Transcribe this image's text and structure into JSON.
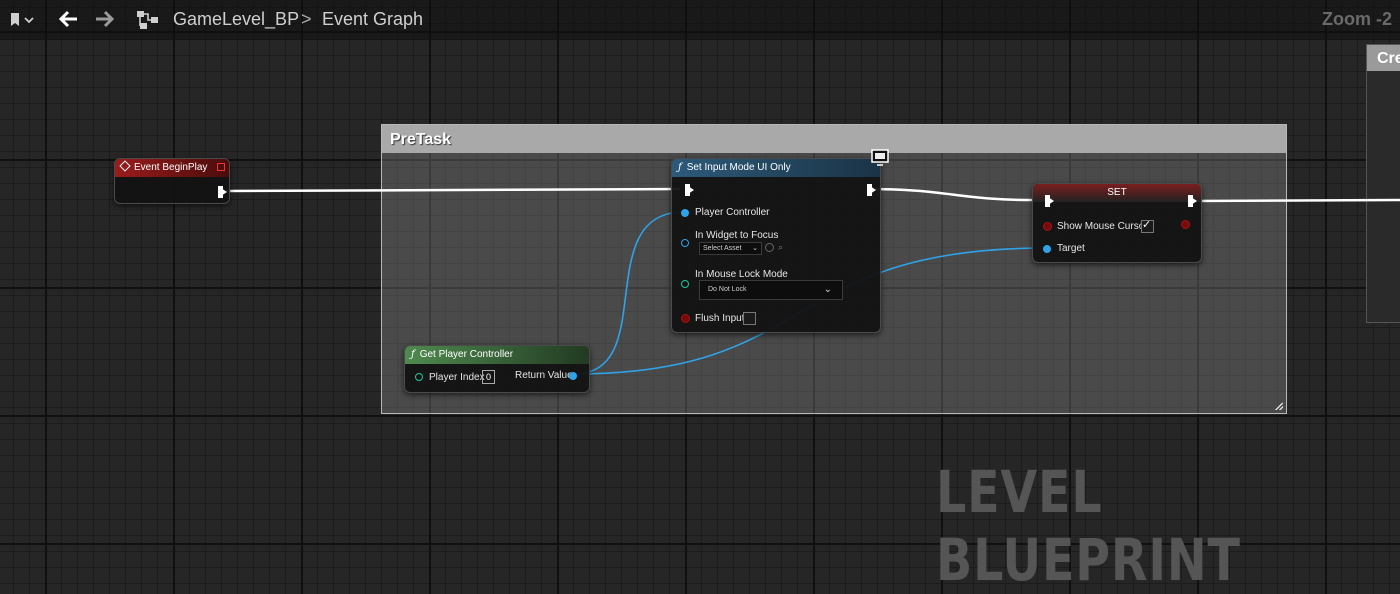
{
  "toolbar": {
    "blueprint_name": "GameLevel_BP",
    "separator": ">",
    "graph_name": "Event Graph",
    "zoom": "Zoom -2"
  },
  "comment": {
    "title": "PreTask"
  },
  "nodes": {
    "begin_play": {
      "title": "Event BeginPlay"
    },
    "set_input_mode": {
      "title": "Set Input Mode UI Only",
      "pins": {
        "player_controller": "Player Controller",
        "widget_to_focus": "In Widget to Focus",
        "widget_select": "Select Asset",
        "mouse_lock_mode": "In Mouse Lock Mode",
        "mouse_lock_value": "Do Not Lock",
        "flush_input": "Flush Input"
      }
    },
    "set": {
      "title": "SET",
      "pins": {
        "show_mouse_cursor": "Show Mouse Cursor",
        "target": "Target"
      }
    },
    "get_player_controller": {
      "title": "Get Player Controller",
      "pins": {
        "player_index": "Player Index",
        "player_index_value": "0",
        "return_value": "Return Value"
      }
    },
    "offscreen_node": {
      "title_partial": "Cre"
    }
  },
  "watermark": "LEVEL BLUEPRINT",
  "colors": {
    "event_header": "#8a1a1a",
    "function_header": "#2a4a63",
    "pure_header": "#3a6a3a",
    "object_pin": "#2fa3e8",
    "bool_pin": "#a51414"
  }
}
